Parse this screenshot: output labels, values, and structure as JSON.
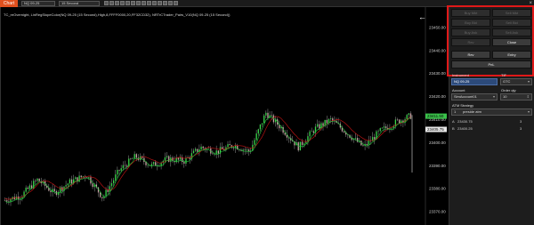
{
  "toolbar": {
    "chart_tab": "Chart",
    "instrument": "NQ 09-25",
    "interval": "15 Second",
    "close": "×"
  },
  "chart": {
    "title": "TC_reOvernight, LinRegSlopeColor(NQ 09-25 (15 Second),High,8,FFFF0000,20,FF32CD32), NRTrCTrader_Pairs_V10(NQ 09-25 (15 Second))",
    "back_arrow": "←",
    "price_labels": [
      {
        "price": 23450,
        "text": "23450.00"
      },
      {
        "price": 23440,
        "text": "23440.00"
      },
      {
        "price": 23430,
        "text": "23430.00"
      },
      {
        "price": 23420,
        "text": "23420.00"
      },
      {
        "price": 23410,
        "text": "23410.00"
      },
      {
        "price": 23400,
        "text": "23400.00"
      },
      {
        "price": 23390,
        "text": "23390.00"
      },
      {
        "price": 23380,
        "text": "23380.00"
      },
      {
        "price": 23370,
        "text": "23370.00"
      }
    ],
    "current_price": {
      "price": 23411.5,
      "text": "23411.50"
    },
    "secondary_price": {
      "price": 23405.75,
      "text": "23405.75"
    },
    "colors": {
      "up": "#3ad64a",
      "down": "#c8a4a4",
      "wick": "#bbbbbb",
      "ma_red": "#cc1414",
      "ma_green": "#22c23a",
      "marker": "#3ac24a"
    }
  },
  "chart_data": {
    "type": "candlestick",
    "ylim": [
      23365,
      23455
    ],
    "y_ticks": [
      23370,
      23380,
      23390,
      23400,
      23410,
      23420,
      23430,
      23440,
      23450
    ],
    "trend_points": [
      [
        0,
        23375
      ],
      [
        25,
        23377
      ],
      [
        50,
        23384
      ],
      [
        75,
        23378
      ],
      [
        100,
        23383
      ],
      [
        125,
        23386
      ],
      [
        150,
        23376
      ],
      [
        175,
        23388
      ],
      [
        200,
        23394
      ],
      [
        225,
        23390
      ],
      [
        250,
        23393
      ],
      [
        275,
        23392
      ],
      [
        300,
        23398
      ],
      [
        325,
        23396
      ],
      [
        350,
        23399
      ],
      [
        375,
        23396
      ],
      [
        400,
        23413
      ],
      [
        425,
        23406
      ],
      [
        450,
        23398
      ],
      [
        475,
        23406
      ],
      [
        500,
        23410
      ],
      [
        525,
        23404
      ],
      [
        550,
        23398
      ],
      [
        575,
        23405
      ],
      [
        600,
        23409
      ],
      [
        625,
        23412
      ]
    ]
  },
  "panel": {
    "buttons_top": [
      {
        "label": "Buy Mkt",
        "dim": true
      },
      {
        "label": "Sell Mkt",
        "dim": true
      },
      {
        "label": "Buy Bid",
        "dim": true
      },
      {
        "label": "Sell Bid",
        "dim": true
      },
      {
        "label": "Buy Ask",
        "dim": true
      },
      {
        "label": "Sell Ask",
        "dim": true
      },
      {
        "label": "Rev",
        "dim": true
      },
      {
        "label": "Close",
        "dim": false
      }
    ],
    "rev_btn": "Rev",
    "entry_btn": "Entry",
    "pnl_btn": "PnL",
    "instrument_label": "Instrument",
    "tif_label": "TIF",
    "instrument_value": "NQ 09-25",
    "tif_value": "GTC",
    "account_label": "Account",
    "order_qty_label": "Order qty",
    "account_value": "SimAccount01",
    "order_qty_value": "10",
    "atm_label": "ATM Strategy",
    "atm_value": "preside atm",
    "atm_count": "1",
    "positions": [
      {
        "side": "A",
        "price": "23430.75",
        "qty": "3"
      },
      {
        "side": "B",
        "price": "23400.25",
        "qty": "3"
      }
    ]
  }
}
